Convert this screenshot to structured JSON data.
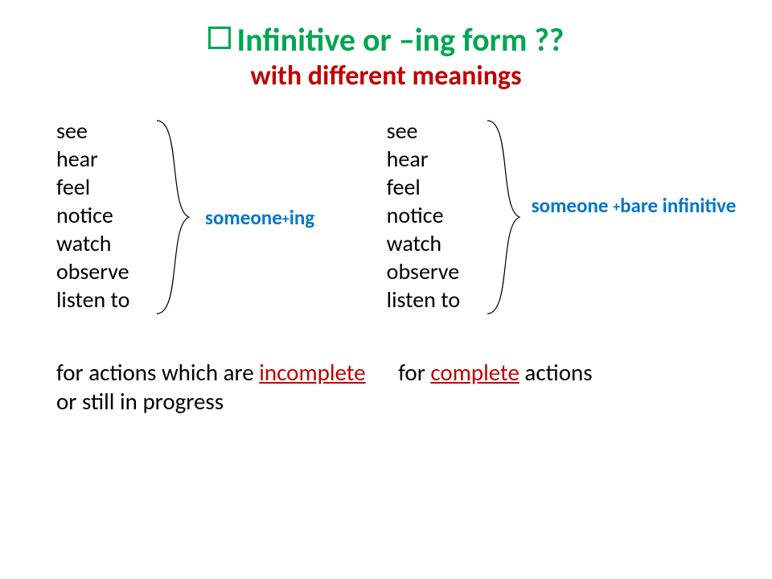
{
  "title": {
    "line1": "Infinitive or –ing form ??",
    "line2": "with different meanings"
  },
  "verbs": {
    "0": "see",
    "1": "hear",
    "2": "feel",
    "3": "notice",
    "4": "watch",
    "5": "observe",
    "6": "listen to"
  },
  "labels": {
    "ing_someone": "someone",
    "ing_suffix": "ing",
    "inf_someone": "someone ",
    "inf_suffix": "bare infinitive",
    "plus": "+"
  },
  "desc": {
    "left_pre": "for actions which are ",
    "left_key": "incomplete",
    "left_post": " or still in progress",
    "right_pre": "for ",
    "right_key": "complete",
    "right_post": " actions"
  }
}
